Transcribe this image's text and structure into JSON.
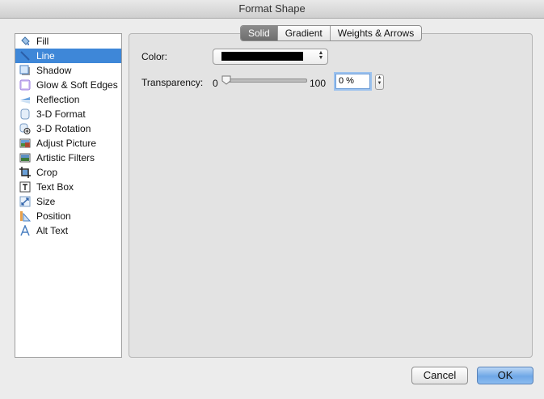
{
  "window": {
    "title": "Format Shape"
  },
  "sidebar": {
    "items": [
      {
        "label": "Fill",
        "icon": "fill-bucket-icon"
      },
      {
        "label": "Line",
        "icon": "line-icon",
        "selected": true
      },
      {
        "label": "Shadow",
        "icon": "shadow-icon"
      },
      {
        "label": "Glow & Soft Edges",
        "icon": "glow-icon"
      },
      {
        "label": "Reflection",
        "icon": "reflection-icon"
      },
      {
        "label": "3-D Format",
        "icon": "3d-format-icon"
      },
      {
        "label": "3-D Rotation",
        "icon": "3d-rotation-icon"
      },
      {
        "label": "Adjust Picture",
        "icon": "adjust-picture-icon"
      },
      {
        "label": "Artistic Filters",
        "icon": "artistic-filters-icon"
      },
      {
        "label": "Crop",
        "icon": "crop-icon"
      },
      {
        "label": "Text Box",
        "icon": "text-box-icon"
      },
      {
        "label": "Size",
        "icon": "size-icon"
      },
      {
        "label": "Position",
        "icon": "position-icon"
      },
      {
        "label": "Alt Text",
        "icon": "alt-text-icon"
      }
    ]
  },
  "tabs": [
    {
      "label": "Solid",
      "active": true
    },
    {
      "label": "Gradient"
    },
    {
      "label": "Weights & Arrows"
    }
  ],
  "line": {
    "color_label": "Color:",
    "color_value": "#000000",
    "transparency_label": "Transparency:",
    "slider_min": "0",
    "slider_max": "100",
    "transparency_value": "0 %",
    "transparency_percent": 0
  },
  "buttons": {
    "cancel": "Cancel",
    "ok": "OK"
  }
}
